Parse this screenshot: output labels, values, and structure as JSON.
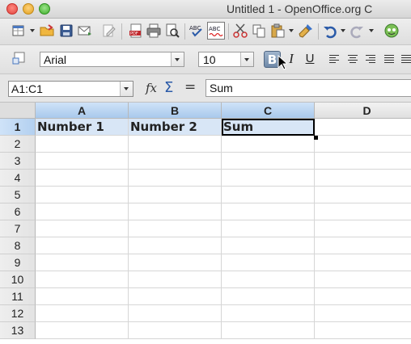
{
  "window": {
    "title": "Untitled 1 - OpenOffice.org C"
  },
  "toolbar": {
    "buttons": [
      "new-icon",
      "open-icon",
      "save-icon",
      "email-icon",
      "edit-file-icon",
      "export-pdf-icon",
      "print-icon",
      "page-preview-icon",
      "spellcheck-icon",
      "autospellcheck-icon",
      "cut-icon",
      "copy-icon",
      "paste-icon",
      "format-paintbrush-icon",
      "undo-icon",
      "redo-icon",
      "navigator-icon"
    ]
  },
  "formatting": {
    "font_name": "Arial",
    "font_size": "10",
    "bold_label": "B",
    "italic_label": "I",
    "underline_label": "U",
    "bold_active": true
  },
  "formula_bar": {
    "name_box": "A1:C1",
    "function_wizard_label": "fx",
    "sum_label": "Σ",
    "equals_label": "=",
    "input_value": "Sum"
  },
  "sheet": {
    "columns": [
      "A",
      "B",
      "C",
      "D"
    ],
    "selected_columns": [
      "A",
      "B",
      "C"
    ],
    "rows": [
      "1",
      "2",
      "3",
      "4",
      "5",
      "6",
      "7",
      "8",
      "9",
      "10",
      "11",
      "12",
      "13"
    ],
    "selected_row": "1",
    "cells": {
      "A1": "Number 1",
      "B1": "Number 2",
      "C1": "Sum"
    },
    "cursor_cell": "C1"
  },
  "colors": {
    "selection": "#d8e6f6",
    "header_selected": "#a9c9ec",
    "bold_active": "#6f89a8"
  }
}
